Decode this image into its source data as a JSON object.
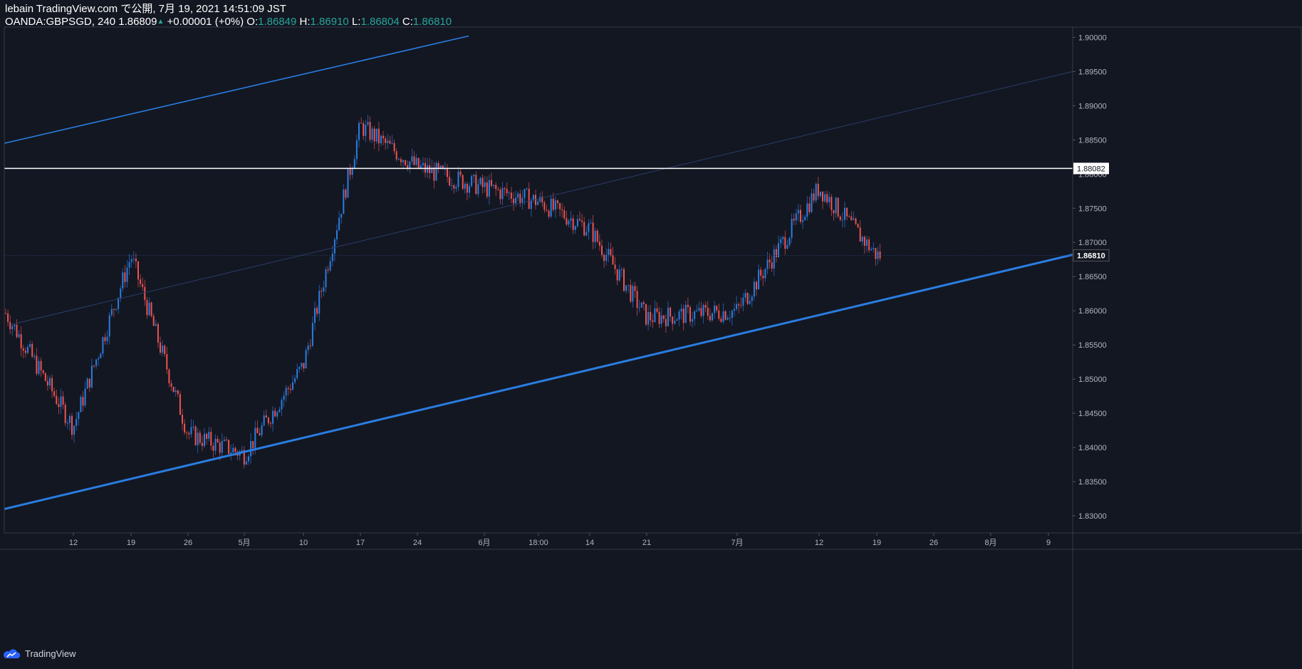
{
  "header": {
    "line1": "lebain TradingView.com で公開, 7月 19, 2021 14:51:09 JST",
    "symbol": "OANDA:GBPSGD, 240",
    "last": "1.86809",
    "arrow": "▲",
    "change": "+0.00001 (+0%)",
    "o_label": "O:",
    "o_val": "1.86849",
    "h_label": "H:",
    "h_val": "1.86910",
    "l_label": "L:",
    "l_val": "1.86804",
    "c_label": "C:",
    "c_val": "1.86810"
  },
  "footer": {
    "brand": "TradingView",
    "logo_icon": "tradingview-cloud-icon"
  },
  "colors": {
    "background": "#131722",
    "up": "#2a7de1",
    "down": "#ef5350",
    "trendline": "#2a7de1",
    "hline": "#ffffff",
    "axis_text": "#b2b5be",
    "label_green": "#26a69a"
  },
  "chart_data": {
    "type": "candlestick",
    "symbol": "OANDA:GBPSGD",
    "interval": "240",
    "ylim": [
      1.8275,
      1.9015
    ],
    "y_ticks": [
      "1.83000",
      "1.83500",
      "1.84000",
      "1.84500",
      "1.85000",
      "1.85500",
      "1.86000",
      "1.86500",
      "1.87000",
      "1.87500",
      "1.88000",
      "1.88500",
      "1.89000",
      "1.89500",
      "1.90000"
    ],
    "x_ticks": [
      "12",
      "19",
      "26",
      "5月",
      "10",
      "17",
      "24",
      "6月",
      "18:00",
      "14",
      "21",
      "7月",
      "12",
      "19",
      "26",
      "8月",
      "9"
    ],
    "price_labels": {
      "horizontal_line": "1.88082",
      "last_price": "1.86810"
    },
    "horizontal_line": 1.88082,
    "last_price": 1.8681,
    "trendlines": [
      {
        "name": "upper channel",
        "from": [
          "start",
          1.8845
        ],
        "to": [
          "6月 (approx)",
          1.9002
        ]
      },
      {
        "name": "lower support",
        "from": [
          "start",
          1.831
        ],
        "to": [
          "end",
          1.8682
        ]
      },
      {
        "name": "mid channel (faint)",
        "from": [
          "start",
          1.858
        ],
        "to": [
          "end",
          1.895
        ]
      }
    ],
    "close_path": [
      [
        "start",
        1.86
      ],
      [
        "12",
        1.843
      ],
      [
        "19",
        1.868
      ],
      [
        "26",
        1.842
      ],
      [
        "5月",
        1.839
      ],
      [
        "10",
        1.852
      ],
      [
        "17",
        1.887
      ],
      [
        "24",
        1.881
      ],
      [
        "6月",
        1.878
      ],
      [
        "18:00",
        1.876
      ],
      [
        "14",
        1.872
      ],
      [
        "21",
        1.859
      ],
      [
        "7月",
        1.86
      ],
      [
        "12",
        1.878
      ],
      [
        "19",
        1.8681
      ]
    ]
  }
}
